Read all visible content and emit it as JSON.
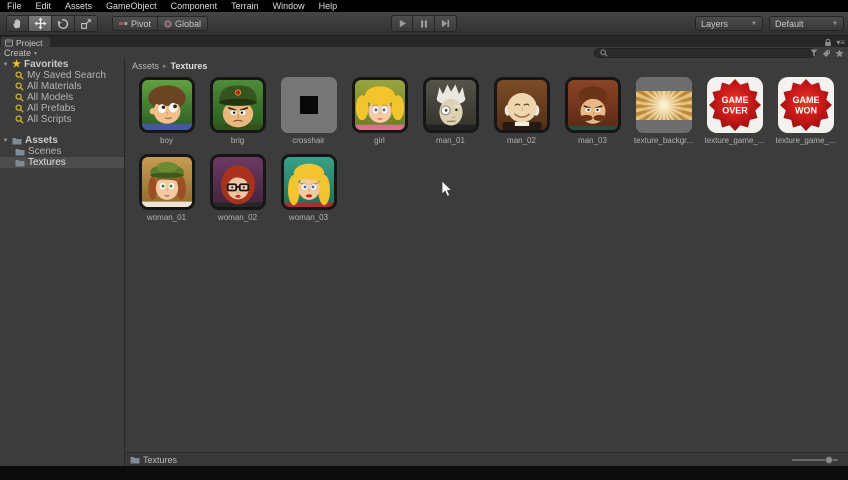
{
  "menus": [
    "File",
    "Edit",
    "Assets",
    "GameObject",
    "Component",
    "Terrain",
    "Window",
    "Help"
  ],
  "toolbar": {
    "pivot": "Pivot",
    "global": "Global",
    "layers": "Layers",
    "layout": "Default"
  },
  "icons": {
    "foldout": "▼",
    "dropdown_caret": "▼",
    "create_caret": "▾",
    "star": "★",
    "panel_menu": "▾≡"
  },
  "project": {
    "tab": "Project",
    "create": "Create",
    "search": {
      "value": "",
      "placeholder": ""
    },
    "breadcrumb": {
      "root": "Assets",
      "separator": "▸",
      "current": "Textures"
    },
    "favorites": {
      "header": "Favorites",
      "items": [
        "My Saved Search",
        "All Materials",
        "All Models",
        "All Prefabs",
        "All Scripts"
      ]
    },
    "tree": {
      "header": "Assets",
      "items": [
        "Scenes",
        "Textures"
      ],
      "selected": "Textures"
    },
    "assets": [
      {
        "name": "boy"
      },
      {
        "name": "brig"
      },
      {
        "name": "crosshair"
      },
      {
        "name": "girl"
      },
      {
        "name": "man_01"
      },
      {
        "name": "man_02"
      },
      {
        "name": "man_03"
      },
      {
        "name": "texture_backgr..."
      },
      {
        "name": "texture_game_...",
        "lines": [
          "GAME",
          "OVER"
        ]
      },
      {
        "name": "texture_game_...",
        "lines": [
          "GAME",
          "WON"
        ]
      },
      {
        "name": "woman_01"
      },
      {
        "name": "woman_02"
      },
      {
        "name": "woman_03"
      }
    ],
    "status": "Textures"
  },
  "colors": {
    "favorite_star": "#f0c420",
    "search_icon": "#d2b42e",
    "folder_icon": "#7d8b96",
    "badge_red": "#cc1a1a",
    "selected_row": "#4d4d4d"
  }
}
